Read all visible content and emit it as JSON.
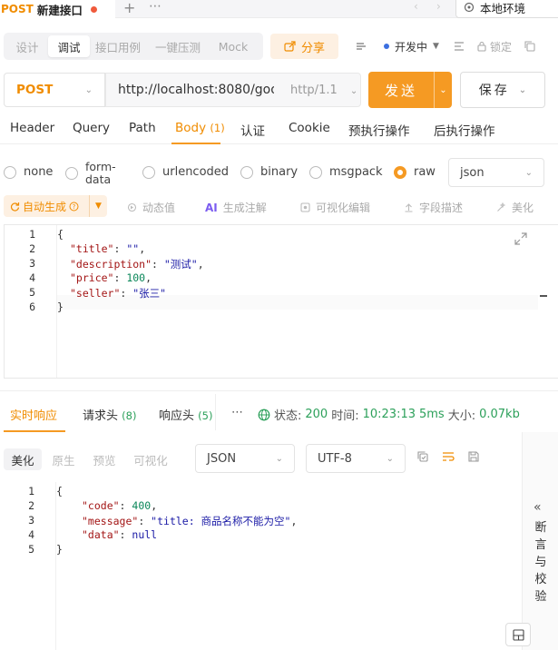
{
  "tab": {
    "method": "POST",
    "title": "新建接口",
    "plus": "+",
    "more": "⋯",
    "back": "‹",
    "fwd": "›",
    "env_label": "本地环境"
  },
  "mode_tabs": [
    "设计",
    "调试",
    "接口用例",
    "一键压测",
    "Mock"
  ],
  "share_label": "分享",
  "env_select": {
    "label": "开发中",
    "lock_label": "锁定"
  },
  "request": {
    "method": "POST",
    "url": "http://localhost:8080/goo",
    "protocol": "http/1.1",
    "send_label": "发送",
    "save_label": "保存"
  },
  "req_tabs": [
    {
      "label": "Header",
      "count": ""
    },
    {
      "label": "Query",
      "count": ""
    },
    {
      "label": "Path",
      "count": ""
    },
    {
      "label": "Body",
      "count": "(1)"
    },
    {
      "label": "认证",
      "count": ""
    },
    {
      "label": "Cookie",
      "count": ""
    },
    {
      "label": "预执行操作",
      "count": ""
    },
    {
      "label": "后执行操作",
      "count": ""
    }
  ],
  "body_types": [
    "none",
    "form-",
    "data",
    "urlencoded",
    "binary",
    "msgpack",
    "raw"
  ],
  "body_format": "json",
  "body_tools": {
    "auto_gen": "自动生成",
    "dynamic": "动态值",
    "ai_badge": "AI",
    "ai_comment": "生成注解",
    "visual_edit": "可视化编辑",
    "field_desc": "字段描述",
    "beautify": "美化"
  },
  "request_body": {
    "line_numbers": [
      "1",
      "2",
      "3",
      "4",
      "5",
      "6"
    ],
    "open_brace": "{",
    "close_brace": "}",
    "fields": [
      {
        "key": "\"title\"",
        "value": "\"\"",
        "tail": ","
      },
      {
        "key": "\"description\"",
        "value": "\"测试\"",
        "tail": ","
      },
      {
        "key": "\"price\"",
        "value": "100",
        "tail": ","
      },
      {
        "key": "\"seller\"",
        "value": "\"张三\"",
        "tail": ""
      }
    ]
  },
  "resp_tabs": [
    {
      "label": "实时响应",
      "count": ""
    },
    {
      "label": "请求头",
      "count": "(8)"
    },
    {
      "label": "响应头",
      "count": "(5)"
    }
  ],
  "resp_more": "⋯",
  "resp_status": {
    "status_label": "状态:",
    "status_value": "200",
    "time_label": "时间:",
    "time_value": "10:23:13",
    "duration": "5ms",
    "size_label": "大小:",
    "size_value": "0.07kb"
  },
  "resp_views": [
    "美化",
    "原生",
    "预览",
    "可视化"
  ],
  "resp_format": "JSON",
  "resp_encoding": "UTF-8",
  "response_body": {
    "line_numbers": [
      "1",
      "2",
      "3",
      "4",
      "5"
    ],
    "open_brace": "{",
    "close_brace": "}",
    "fields": [
      {
        "key": "\"code\"",
        "value": "400",
        "tail": ","
      },
      {
        "key": "\"message\"",
        "value": "\"title: 商品名称不能为空\"",
        "tail": ","
      },
      {
        "key": "\"data\"",
        "value": "null",
        "tail": ""
      }
    ]
  },
  "side_panel": {
    "chevron": "«",
    "chars": [
      "断",
      "言",
      "与",
      "校",
      "验"
    ]
  }
}
